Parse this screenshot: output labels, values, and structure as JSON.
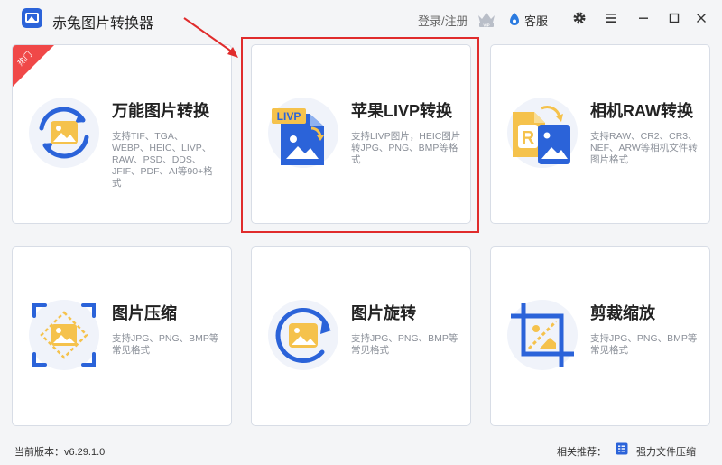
{
  "app": {
    "title": "赤兔图片转换器"
  },
  "header": {
    "login_label": "登录/注册",
    "vip_badge": "VIP",
    "service_label": "客服"
  },
  "window_controls": [
    "settings-icon",
    "menu-icon",
    "minimize-icon",
    "maximize-icon",
    "close-icon"
  ],
  "cards": [
    {
      "title": "万能图片转换",
      "desc": "支持TIF、TGA、WEBP、HEIC、LIVP、RAW、PSD、DDS、JFIF、PDF、AI等90+格式",
      "badge": "热门",
      "icon": "universal-convert-icon"
    },
    {
      "title": "苹果LIVP转换",
      "desc": "支持LIVP图片，HEIC图片转JPG、PNG、BMP等格式",
      "icon_label": "LIVP",
      "icon": "livp-convert-icon"
    },
    {
      "title": "相机RAW转换",
      "desc": "支持RAW、CR2、CR3、NEF、ARW等相机文件转图片格式",
      "icon_label": "R",
      "icon": "raw-convert-icon"
    },
    {
      "title": "图片压缩",
      "desc": "支持JPG、PNG、BMP等常见格式",
      "icon": "compress-icon"
    },
    {
      "title": "图片旋转",
      "desc": "支持JPG、PNG、BMP等常见格式",
      "icon": "rotate-icon"
    },
    {
      "title": "剪裁缩放",
      "desc": "支持JPG、PNG、BMP等常见格式",
      "icon": "crop-icon"
    }
  ],
  "status": {
    "version_label": "当前版本：",
    "version": "v6.29.1.0",
    "related_label": "相关推荐：",
    "related_link": "强力文件压缩"
  },
  "colors": {
    "primary_blue": "#2b63d9",
    "image_yellow": "#f5c24c",
    "highlight_red": "#e02c2c",
    "hot_red": "#f04848"
  }
}
